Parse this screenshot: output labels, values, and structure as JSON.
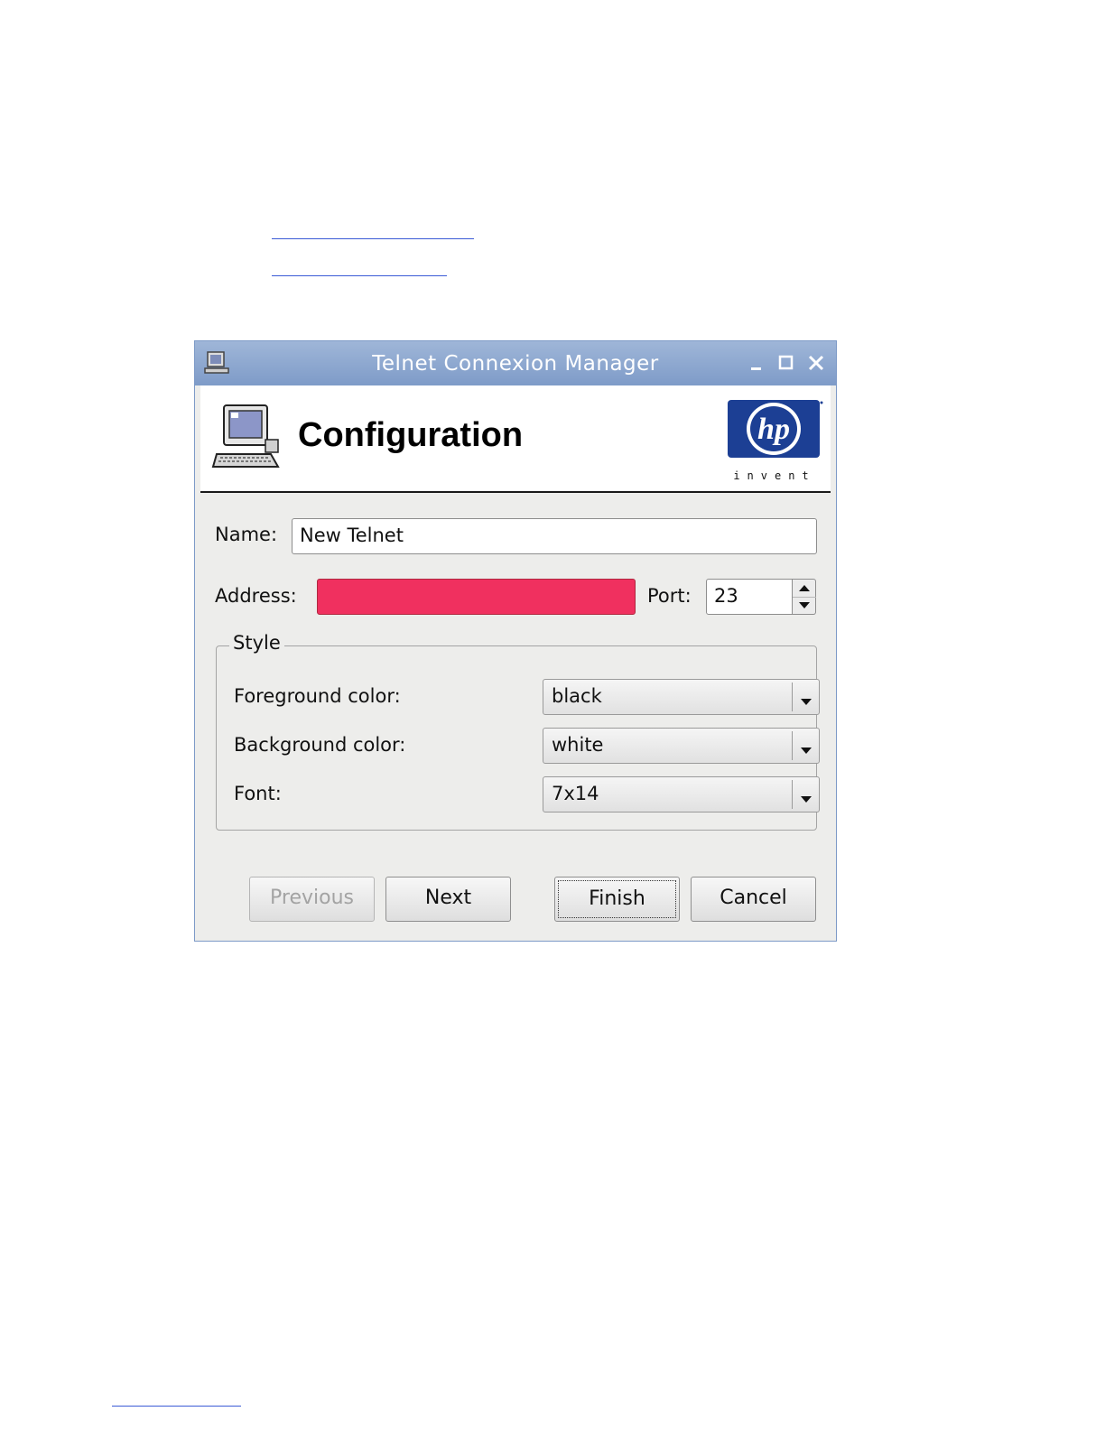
{
  "window": {
    "title": "Telnet Connexion Manager"
  },
  "header": {
    "title": "Configuration",
    "logo_text": "hp",
    "logo_tagline": "invent"
  },
  "form": {
    "name_label": "Name:",
    "name_value": "New Telnet",
    "address_label": "Address:",
    "address_value": "",
    "address_error_color": "#f0305f",
    "port_label": "Port:",
    "port_value": "23"
  },
  "style_group": {
    "legend": "Style",
    "foreground_label": "Foreground color:",
    "foreground_value": "black",
    "background_label": "Background color:",
    "background_value": "white",
    "font_label": "Font:",
    "font_value": "7x14"
  },
  "buttons": {
    "previous": "Previous",
    "next": "Next",
    "finish": "Finish",
    "cancel": "Cancel"
  },
  "icons": [
    "computer-icon",
    "minimize-icon",
    "maximize-icon",
    "close-icon",
    "spin-up-icon",
    "spin-down-icon",
    "dropdown-arrow-icon"
  ],
  "colors": {
    "titlebar": "#8aa5cf",
    "window_bg": "#ededeb",
    "link_rule": "#3b5bd6",
    "hp_blue": "#1c3f94"
  }
}
